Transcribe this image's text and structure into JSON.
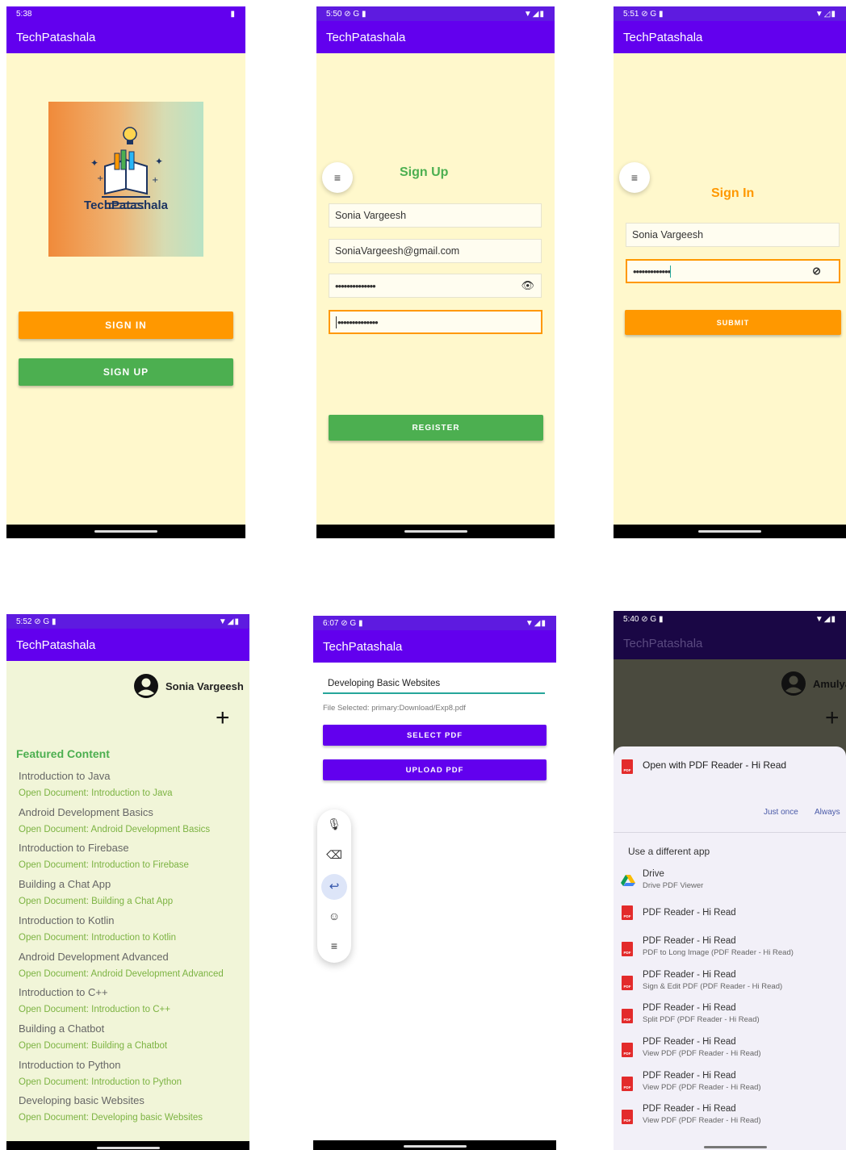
{
  "app_title": "TechPatashala",
  "colors": {
    "primary": "#6200ee",
    "accent_orange": "#ff9800",
    "accent_green": "#4caf50",
    "bg_cream": "#fff8cc",
    "bg_list": "#f1f5d8"
  },
  "screen1": {
    "time": "5:38",
    "logo_text": "TechPatashala",
    "signin_label": "SIGN IN",
    "signup_label": "SIGN UP"
  },
  "screen2": {
    "time": "5:50",
    "title": "Sign Up",
    "name_value": "Sonia Vargeesh",
    "email_value": "SoniaVargeesh@gmail.com",
    "password_mask": "••••••••••••••",
    "confirm_mask": "••••••••••••••",
    "register_label": "REGISTER"
  },
  "screen3": {
    "time": "5:51",
    "title": "Sign In",
    "name_value": "Sonia Vargeesh",
    "password_mask": "•••••••••••••",
    "submit_label": "SUBMIT"
  },
  "screen4": {
    "time": "5:52",
    "user_name": "Sonia Vargeesh",
    "section_title": "Featured Content",
    "items": [
      {
        "title": "Introduction to Java",
        "link": "Open Document: Introduction to Java"
      },
      {
        "title": "Android Development Basics",
        "link": "Open Document: Android Development Basics"
      },
      {
        "title": "Introduction to Firebase",
        "link": "Open Document: Introduction to Firebase"
      },
      {
        "title": "Building a Chat App",
        "link": "Open Document: Building a Chat App"
      },
      {
        "title": "Introduction to Kotlin",
        "link": "Open Document: Introduction to Kotlin"
      },
      {
        "title": "Android Development Advanced",
        "link": "Open Document: Android Development Advanced"
      },
      {
        "title": "Introduction to C++",
        "link": "Open Document: Introduction to C++"
      },
      {
        "title": "Building a Chatbot",
        "link": "Open Document: Building a Chatbot"
      },
      {
        "title": "Introduction to Python",
        "link": "Open Document: Introduction to Python"
      },
      {
        "title": "Developing basic Websites",
        "link": "Open Document: Developing basic Websites"
      }
    ]
  },
  "screen5": {
    "time": "6:07",
    "title_input": "Developing Basic Websites",
    "file_selected": "File Selected: primary:Download/Exp8.pdf",
    "select_label": "SELECT PDF",
    "upload_label": "UPLOAD PDF",
    "keyboard_tools": [
      "mic-icon",
      "backspace-icon",
      "enter-icon",
      "emoji-icon",
      "menu-icon"
    ]
  },
  "screen6": {
    "time": "5:40",
    "user_name_partial": "Amulya",
    "open_with": "Open with PDF Reader - Hi Read",
    "just_once": "Just once",
    "always": "Always",
    "use_different": "Use a different app",
    "apps": [
      {
        "title": "Drive",
        "sub": "Drive PDF Viewer",
        "icon": "drive-icon"
      },
      {
        "title": "PDF Reader - Hi Read",
        "sub": "",
        "icon": "pdf-icon"
      },
      {
        "title": "PDF Reader - Hi Read",
        "sub": "PDF to Long Image (PDF Reader - Hi Read)",
        "icon": "pdf-icon"
      },
      {
        "title": "PDF Reader - Hi Read",
        "sub": "Sign & Edit PDF (PDF Reader - Hi Read)",
        "icon": "pdf-icon"
      },
      {
        "title": "PDF Reader - Hi Read",
        "sub": "Split PDF (PDF Reader - Hi Read)",
        "icon": "pdf-icon"
      },
      {
        "title": "PDF Reader - Hi Read",
        "sub": "View PDF (PDF Reader - Hi Read)",
        "icon": "pdf-icon"
      },
      {
        "title": "PDF Reader - Hi Read",
        "sub": "View PDF (PDF Reader - Hi Read)",
        "icon": "pdf-icon"
      },
      {
        "title": "PDF Reader - Hi Read",
        "sub": "View PDF (PDF Reader - Hi Read)",
        "icon": "pdf-icon"
      }
    ]
  }
}
